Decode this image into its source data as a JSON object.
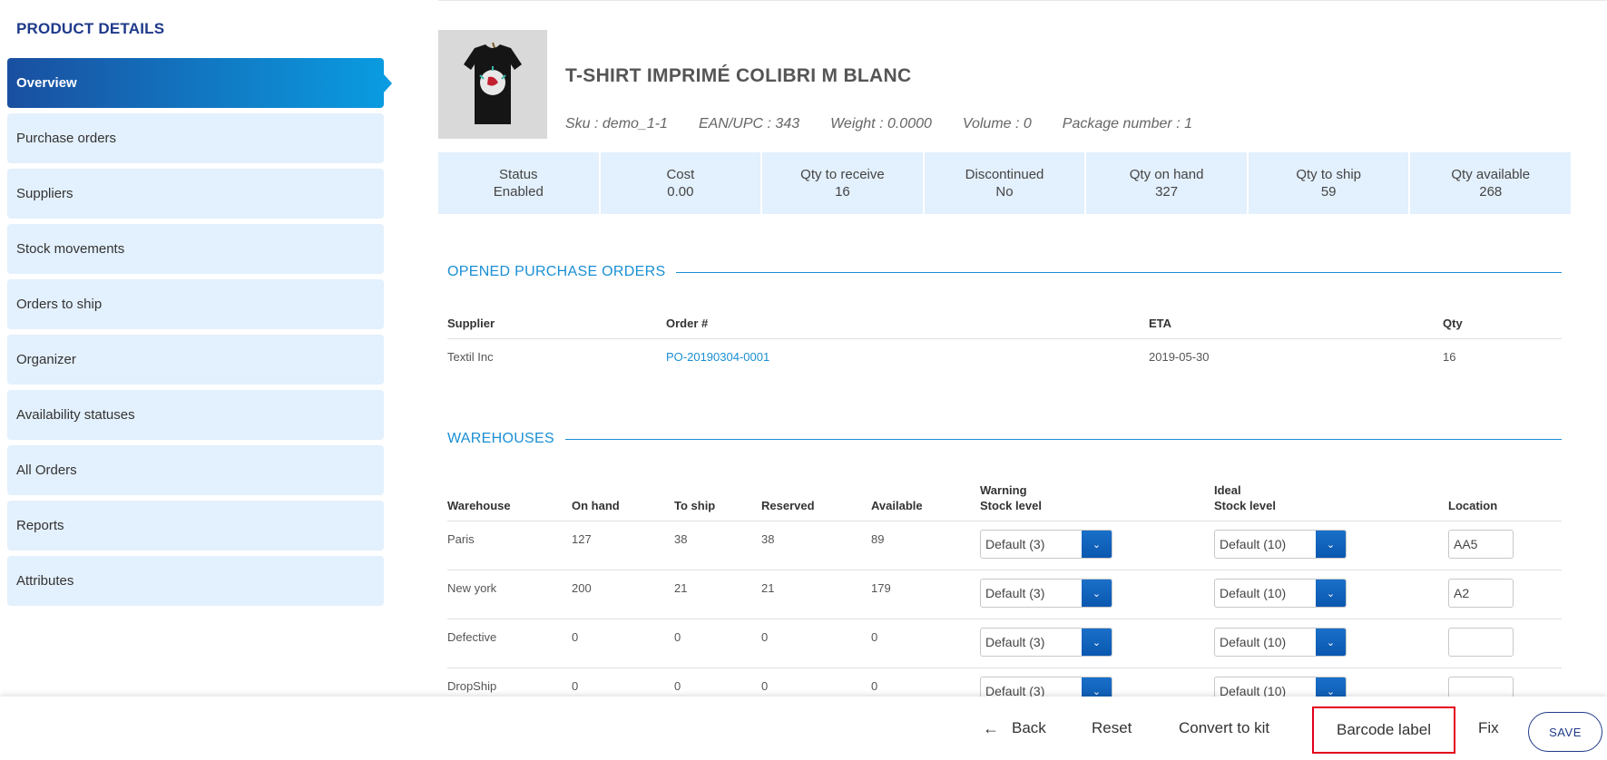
{
  "sidebar": {
    "title": "PRODUCT DETAILS",
    "items": [
      {
        "label": "Overview"
      },
      {
        "label": "Purchase orders"
      },
      {
        "label": "Suppliers"
      },
      {
        "label": "Stock movements"
      },
      {
        "label": "Orders to ship"
      },
      {
        "label": "Organizer"
      },
      {
        "label": "Availability statuses"
      },
      {
        "label": "All Orders"
      },
      {
        "label": "Reports"
      },
      {
        "label": "Attributes"
      }
    ]
  },
  "product": {
    "name": "T-SHIRT IMPRIMÉ COLIBRI M BLANC",
    "sku": "Sku : demo_1-1",
    "ean": "EAN/UPC : 343",
    "weight": "Weight : 0.0000",
    "volume": "Volume : 0",
    "package": "Package number : 1"
  },
  "stats": [
    {
      "label": "Status",
      "value": "Enabled"
    },
    {
      "label": "Cost",
      "value": "0.00"
    },
    {
      "label": "Qty to receive",
      "value": "16"
    },
    {
      "label": "Discontinued",
      "value": "No"
    },
    {
      "label": "Qty on hand",
      "value": "327"
    },
    {
      "label": "Qty to ship",
      "value": "59"
    },
    {
      "label": "Qty available",
      "value": "268"
    }
  ],
  "purchase_orders": {
    "title": "OPENED PURCHASE ORDERS",
    "headers": [
      "Supplier",
      "Order #",
      "ETA",
      "Qty"
    ],
    "rows": [
      [
        "Textil Inc",
        "PO-20190304-0001",
        "2019-05-30",
        "16"
      ]
    ]
  },
  "warehouses": {
    "title": "WAREHOUSES",
    "headers": {
      "warehouse": "Warehouse",
      "on_hand": "On hand",
      "to_ship": "To ship",
      "reserved": "Reserved",
      "available": "Available",
      "warning_1": "Warning",
      "warning_2": "Stock level",
      "ideal_1": "Ideal",
      "ideal_2": "Stock level",
      "location": "Location"
    },
    "rows": [
      {
        "name": "Paris",
        "on_hand": "127",
        "to_ship": "38",
        "reserved": "38",
        "available": "89",
        "warning": "Default (3)",
        "ideal": "Default (10)",
        "location": "AA5"
      },
      {
        "name": "New york",
        "on_hand": "200",
        "to_ship": "21",
        "reserved": "21",
        "available": "179",
        "warning": "Default (3)",
        "ideal": "Default (10)",
        "location": "A2"
      },
      {
        "name": "Defective",
        "on_hand": "0",
        "to_ship": "0",
        "reserved": "0",
        "available": "0",
        "warning": "Default (3)",
        "ideal": "Default (10)",
        "location": ""
      },
      {
        "name": "DropShip",
        "on_hand": "0",
        "to_ship": "0",
        "reserved": "0",
        "available": "0",
        "warning": "Default (3)",
        "ideal": "Default (10)",
        "location": ""
      }
    ]
  },
  "footer": {
    "back": "Back",
    "reset": "Reset",
    "convert": "Convert to kit",
    "barcode": "Barcode label",
    "fix": "Fix",
    "save": "SAVE"
  },
  "icons": {
    "back": "arrow-left-icon",
    "select": "chevron-down-icon"
  },
  "colors": {
    "brand": "#1f3a8a",
    "accent": "#1a8fd4",
    "nav_bg": "#e3f0fd",
    "highlight": "#e3001b"
  }
}
